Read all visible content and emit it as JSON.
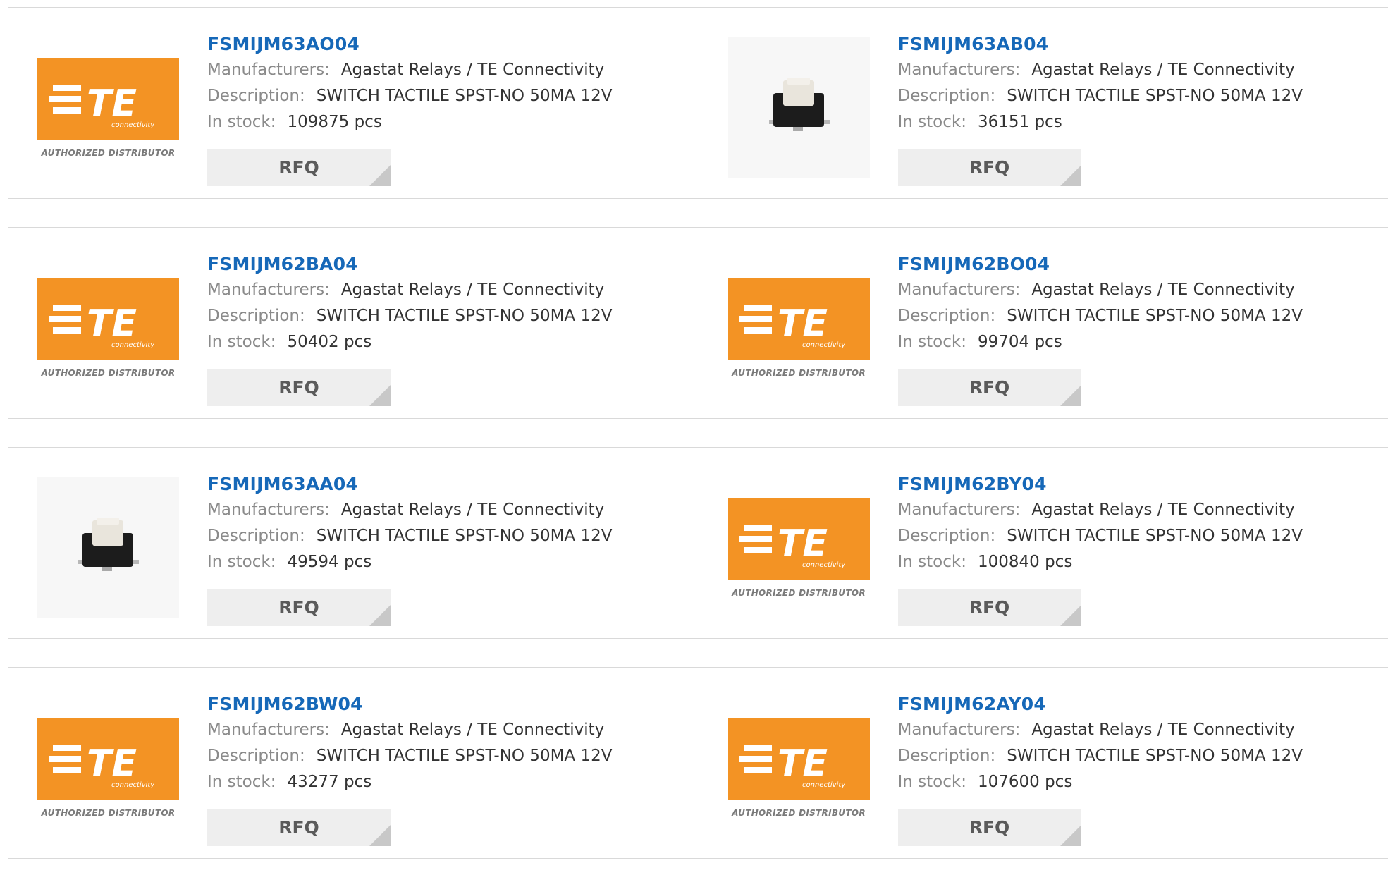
{
  "logo": {
    "brand_text": "TE",
    "brand_sub": "connectivity",
    "authorized": "AUTHORIZED DISTRIBUTOR",
    "brand_color": "#f39324"
  },
  "labels": {
    "manufacturers": "Manufacturers:",
    "description": "Description:",
    "in_stock": "In stock:",
    "rfq": "RFQ"
  },
  "colors": {
    "part_link": "#1668b8",
    "button_bg": "#eeeeee"
  },
  "products": [
    {
      "part": "FSMIJM63AO04",
      "manufacturer": "Agastat Relays / TE Connectivity",
      "description": "SWITCH TACTILE SPST-NO 50MA 12V",
      "stock": "109875 pcs",
      "image": "te-logo"
    },
    {
      "part": "FSMIJM63AB04",
      "manufacturer": "Agastat Relays / TE Connectivity",
      "description": "SWITCH TACTILE SPST-NO 50MA 12V",
      "stock": "36151 pcs",
      "image": "switch-photo"
    },
    {
      "part": "FSMIJM62BA04",
      "manufacturer": "Agastat Relays / TE Connectivity",
      "description": "SWITCH TACTILE SPST-NO 50MA 12V",
      "stock": "50402 pcs",
      "image": "te-logo"
    },
    {
      "part": "FSMIJM62BO04",
      "manufacturer": "Agastat Relays / TE Connectivity",
      "description": "SWITCH TACTILE SPST-NO 50MA 12V",
      "stock": "99704 pcs",
      "image": "te-logo"
    },
    {
      "part": "FSMIJM63AA04",
      "manufacturer": "Agastat Relays / TE Connectivity",
      "description": "SWITCH TACTILE SPST-NO 50MA 12V",
      "stock": "49594 pcs",
      "image": "switch-photo"
    },
    {
      "part": "FSMIJM62BY04",
      "manufacturer": "Agastat Relays / TE Connectivity",
      "description": "SWITCH TACTILE SPST-NO 50MA 12V",
      "stock": "100840 pcs",
      "image": "te-logo"
    },
    {
      "part": "FSMIJM62BW04",
      "manufacturer": "Agastat Relays / TE Connectivity",
      "description": "SWITCH TACTILE SPST-NO 50MA 12V",
      "stock": "43277 pcs",
      "image": "te-logo"
    },
    {
      "part": "FSMIJM62AY04",
      "manufacturer": "Agastat Relays / TE Connectivity",
      "description": "SWITCH TACTILE SPST-NO 50MA 12V",
      "stock": "107600 pcs",
      "image": "te-logo"
    }
  ]
}
